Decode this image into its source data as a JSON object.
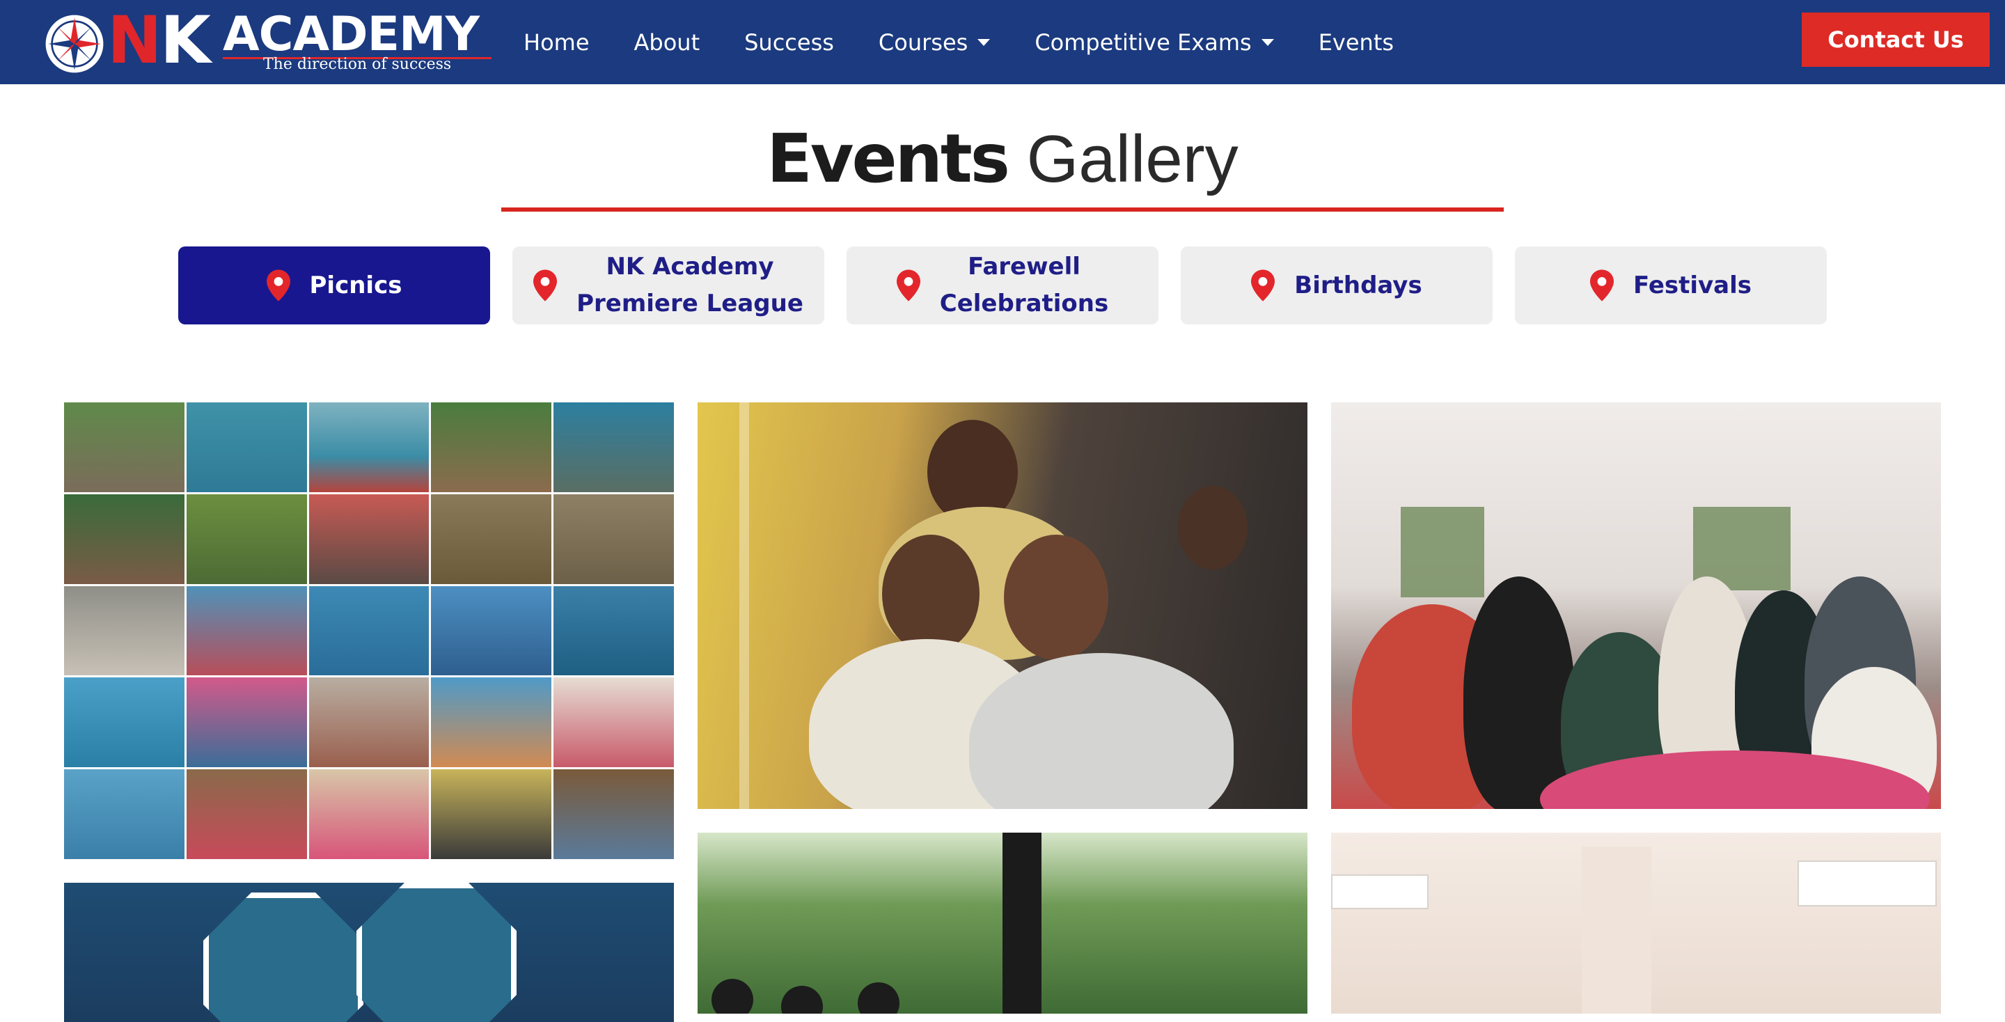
{
  "brand": {
    "letter_n": "N",
    "letter_k": "K",
    "word": "ACADEMY",
    "tagline": "The direction of success",
    "colors": {
      "navy": "#1b3a7f",
      "red": "#e0262b"
    }
  },
  "nav": {
    "items": [
      {
        "label": "Home",
        "dropdown": false
      },
      {
        "label": "About",
        "dropdown": false
      },
      {
        "label": "Success",
        "dropdown": false
      },
      {
        "label": "Courses",
        "dropdown": true
      },
      {
        "label": "Competitive Exams",
        "dropdown": true
      },
      {
        "label": "Events",
        "dropdown": false
      }
    ],
    "contact_label": "Contact Us"
  },
  "heading": {
    "bold": "Events",
    "light": "Gallery"
  },
  "tabs": [
    {
      "line1": "Picnics",
      "line2": "",
      "active": true,
      "icon": "map-pin-icon"
    },
    {
      "line1": "NK Academy",
      "line2": "Premiere League",
      "active": false,
      "icon": "map-pin-icon"
    },
    {
      "line1": "Farewell",
      "line2": "Celebrations",
      "active": false,
      "icon": "map-pin-icon"
    },
    {
      "line1": "Birthdays",
      "line2": "",
      "active": false,
      "icon": "map-pin-icon"
    },
    {
      "line1": "Festivals",
      "line2": "",
      "active": false,
      "icon": "map-pin-icon"
    }
  ],
  "gallery": {
    "photos": [
      {
        "kind": "picnic-collage"
      },
      {
        "kind": "students-on-bus"
      },
      {
        "kind": "group-at-restaurant"
      },
      {
        "kind": "framed-group-photos"
      },
      {
        "kind": "outdoor-garden"
      },
      {
        "kind": "indoor-room"
      }
    ]
  },
  "icon_names": [
    "compass-logo-icon",
    "chevron-down-icon",
    "map-pin-icon"
  ],
  "accent": {
    "active_tab": "#18178f",
    "button": "#de2b26",
    "rule": "#d8261f"
  }
}
